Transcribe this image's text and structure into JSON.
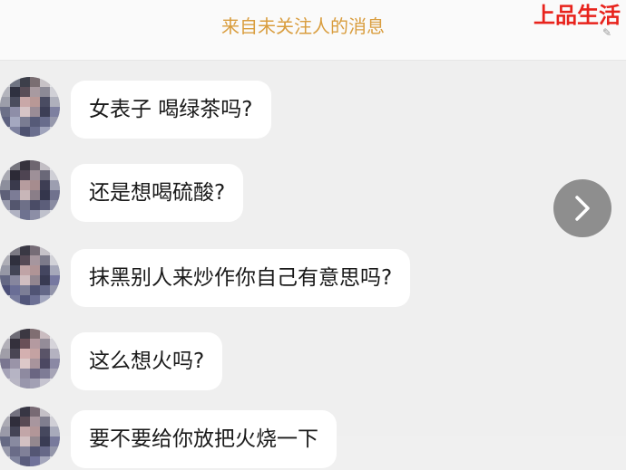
{
  "header": {
    "title": "来自未关注人的消息"
  },
  "watermark": {
    "text": "上品生活"
  },
  "messages": [
    {
      "text": "女表子 喝绿茶吗?"
    },
    {
      "text": "还是想喝硫酸?"
    },
    {
      "text": "抹黑别人来炒作你自己有意思吗?"
    },
    {
      "text": "这么想火吗?"
    },
    {
      "text": "要不要给你放把火烧一下"
    }
  ],
  "next_button": {
    "icon": "chevron-right-icon"
  },
  "colors": {
    "header_title": "#d99d3e",
    "watermark": "#e8231c",
    "bubble_bg": "#ffffff",
    "chat_bg": "#efefef",
    "next_button_bg": "#8e8e8e"
  }
}
